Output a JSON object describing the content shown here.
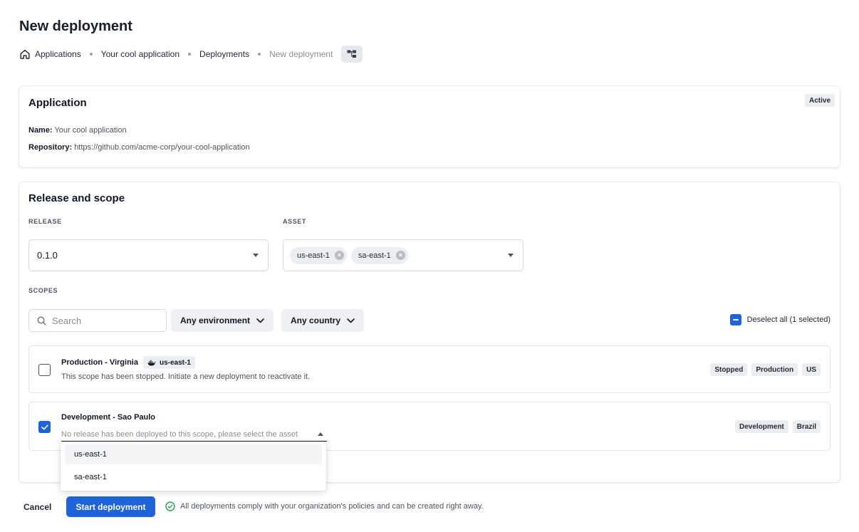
{
  "page": {
    "title": "New deployment"
  },
  "breadcrumb": {
    "items": [
      "Applications",
      "Your cool application",
      "Deployments",
      "New deployment"
    ]
  },
  "application": {
    "title": "Application",
    "status": "Active",
    "name_label": "Name:",
    "name_value": "Your cool application",
    "repo_label": "Repository:",
    "repo_value": "https://github.com/acme-corp/your-cool-application"
  },
  "release_scope": {
    "title": "Release and scope",
    "release_label": "RELEASE",
    "release_value": "0.1.0",
    "asset_label": "ASSET",
    "assets": [
      "us-east-1",
      "sa-east-1"
    ],
    "scopes_label": "SCOPES",
    "search_placeholder": "Search",
    "env_filter": "Any environment",
    "country_filter": "Any country",
    "deselect_label": "Deselect all (1 selected)",
    "scopes": [
      {
        "name": "Production - Virginia",
        "asset": "us-east-1",
        "description": "This scope has been stopped. Initiate a new deployment to reactivate it.",
        "checked": false,
        "tags": [
          "Stopped",
          "Production",
          "US"
        ]
      },
      {
        "name": "Development - Sao Paulo",
        "asset_placeholder": "No release has been deployed to this scope, please select the asset",
        "checked": true,
        "tags": [
          "Development",
          "Brazil"
        ]
      }
    ],
    "dropdown_options": [
      "us-east-1",
      "sa-east-1"
    ]
  },
  "footer": {
    "cancel_label": "Cancel",
    "start_label": "Start deployment",
    "notice": "All deployments comply with your organization's policies and can be created right away."
  },
  "colors": {
    "primary": "#1e64d8",
    "success": "#22a05b"
  }
}
